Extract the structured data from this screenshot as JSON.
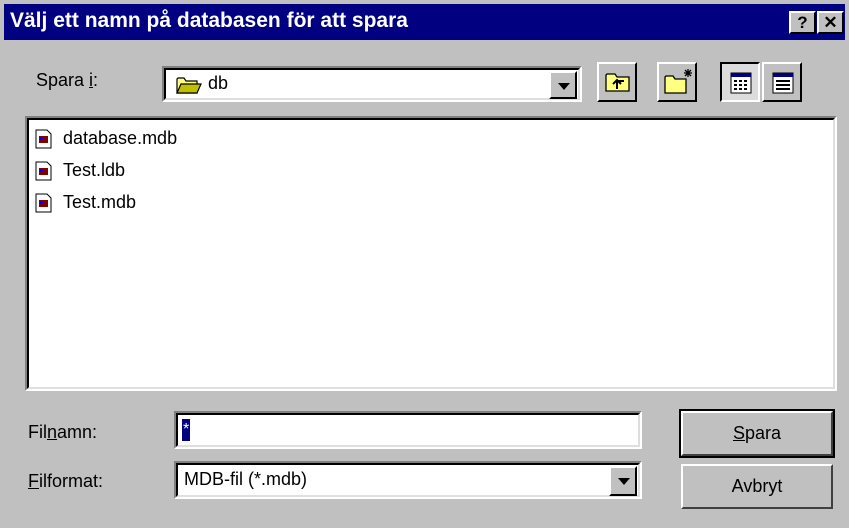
{
  "window": {
    "title": "Välj ett namn på databasen för att spara",
    "help_button": "?",
    "close_button": "✕"
  },
  "save_in": {
    "label_prefix": "Spara ",
    "label_accel": "i",
    "label_suffix": ":",
    "folder_value": "db"
  },
  "files": [
    {
      "name": "database.mdb"
    },
    {
      "name": "Test.ldb"
    },
    {
      "name": "Test.mdb"
    }
  ],
  "filename": {
    "label_prefix": "Fil",
    "label_accel": "n",
    "label_suffix": "amn:",
    "value": "*"
  },
  "filetype": {
    "label_accel": "F",
    "label_suffix": "ilformat:",
    "value": "MDB-fil (*.mdb)"
  },
  "buttons": {
    "save_accel": "S",
    "save_rest": "para",
    "cancel": "Avbryt"
  },
  "colors": {
    "titlebar": "#000080",
    "face": "#c0c0c0",
    "selection": "#000080"
  }
}
